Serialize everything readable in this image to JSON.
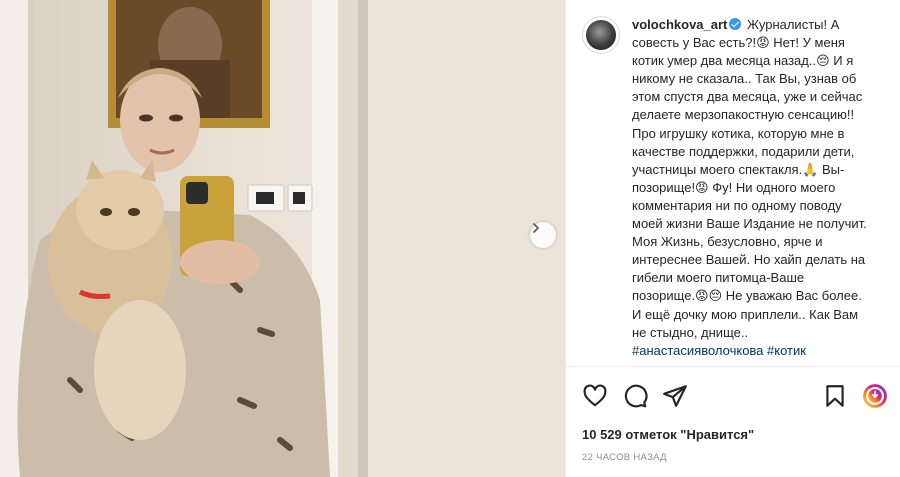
{
  "post": {
    "username": "volochkova_art",
    "verified": true,
    "caption_lines": [
      "Журналисты! А",
      "совесть у Вас есть?!😡 Нет! У меня",
      "котик умер два месяца назад..😔 И я",
      "никому не сказала.. Так Вы, узнав об",
      "этом спустя два месяца, уже и сейчас",
      "делаете мерзопакостную сенсацию!!",
      "Про игрушку котика, которую мне в",
      "качестве поддержки, подарили дети,",
      "участницы моего спектакля.🙏 Вы-",
      "позорище!😡 Фу! Ни одного моего",
      "комментария ни по одному поводу",
      "моей жизни Ваше Издание не получит.",
      "Моя Жизнь, безусловно, ярче и",
      "интереснее Вашей. Но хайп делать на",
      "гибели моего питомца-Ваше",
      "позорище.😡😔 Не уважаю Вас более.",
      "И ещё дочку мою приплели.. Как Вам",
      "не стыдно, днище.."
    ],
    "hashtags": [
      "#анастасияволочкова",
      "#котик"
    ],
    "likes_text": "10 529 отметок \"Нравится\"",
    "timestamp": "22 часов назад"
  },
  "icons": {
    "like": "heart-icon",
    "comment": "comment-icon",
    "share": "paper-plane-icon",
    "save": "bookmark-icon",
    "next": "chevron-right-icon",
    "stories": "instagram-icon"
  },
  "colors": {
    "text": "#262626",
    "muted": "#8e8e8e",
    "hashtag": "#00376b",
    "verified": "#3897f0",
    "border": "#efefef"
  }
}
